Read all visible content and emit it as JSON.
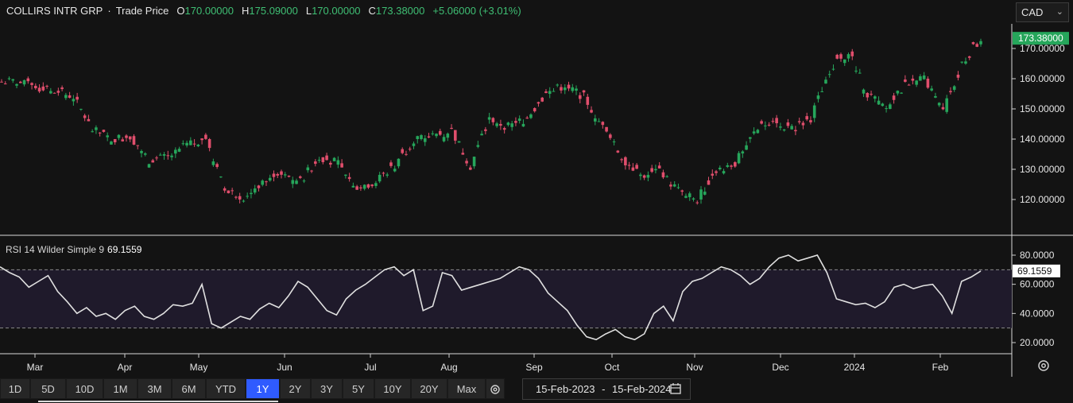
{
  "header": {
    "symbol": "COLLIRS INTR GRP",
    "separator": "·",
    "price_type": "Trade Price",
    "open_label": "O",
    "open": "170.00000",
    "high_label": "H",
    "high": "175.09000",
    "low_label": "L",
    "low": "170.00000",
    "close_label": "C",
    "close": "173.38000",
    "change": "+5.06000 (+3.01%)"
  },
  "currency_select": {
    "value": "CAD",
    "icon": "chevron-down-icon"
  },
  "colors": {
    "background": "#131313",
    "up": "#26a65b",
    "down": "#e04e6c",
    "rsi_line": "#e0e0e0",
    "rsi_band": "#1f1a2b",
    "active": "#2f5bff"
  },
  "rsi": {
    "label": "RSI 14 Wilder Simple 9",
    "value": "69.1559"
  },
  "range_buttons": [
    "1D",
    "5D",
    "10D",
    "1M",
    "3M",
    "6M",
    "YTD",
    "1Y",
    "2Y",
    "3Y",
    "5Y",
    "10Y",
    "20Y",
    "Max"
  ],
  "active_range": "1Y",
  "date_range": {
    "from": "15-Feb-2023",
    "separator": "-",
    "to": "15-Feb-2024",
    "icon": "calendar-icon"
  },
  "chart_data": [
    {
      "type": "candlestick",
      "title": "COLLIRS INTR GRP · Trade Price",
      "x_labels": [
        "Mar",
        "Apr",
        "May",
        "Jun",
        "Jul",
        "Aug",
        "Sep",
        "Oct",
        "Nov",
        "Dec",
        "2024",
        "Feb"
      ],
      "y_ticks": [
        "120.00000",
        "130.00000",
        "140.00000",
        "150.00000",
        "160.00000",
        "170.00000"
      ],
      "ylim": [
        110,
        180
      ],
      "last_price_label": "173.38000",
      "weekly_close_approx": [
        {
          "week": "2023-02-17",
          "close": 159
        },
        {
          "week": "2023-02-24",
          "close": 157
        },
        {
          "week": "2023-03-03",
          "close": 156
        },
        {
          "week": "2023-03-10",
          "close": 154
        },
        {
          "week": "2023-03-17",
          "close": 143
        },
        {
          "week": "2023-03-24",
          "close": 140
        },
        {
          "week": "2023-03-31",
          "close": 141
        },
        {
          "week": "2023-04-07",
          "close": 133
        },
        {
          "week": "2023-04-14",
          "close": 134
        },
        {
          "week": "2023-04-21",
          "close": 138
        },
        {
          "week": "2023-04-28",
          "close": 140
        },
        {
          "week": "2023-05-05",
          "close": 123
        },
        {
          "week": "2023-05-12",
          "close": 121
        },
        {
          "week": "2023-05-19",
          "close": 126
        },
        {
          "week": "2023-05-26",
          "close": 128
        },
        {
          "week": "2023-06-02",
          "close": 126
        },
        {
          "week": "2023-06-09",
          "close": 134
        },
        {
          "week": "2023-06-16",
          "close": 132
        },
        {
          "week": "2023-06-23",
          "close": 124
        },
        {
          "week": "2023-06-30",
          "close": 126
        },
        {
          "week": "2023-07-07",
          "close": 131
        },
        {
          "week": "2023-07-14",
          "close": 140
        },
        {
          "week": "2023-07-21",
          "close": 141
        },
        {
          "week": "2023-07-28",
          "close": 143
        },
        {
          "week": "2023-08-04",
          "close": 131
        },
        {
          "week": "2023-08-11",
          "close": 147
        },
        {
          "week": "2023-08-18",
          "close": 144
        },
        {
          "week": "2023-08-25",
          "close": 147
        },
        {
          "week": "2023-09-01",
          "close": 155
        },
        {
          "week": "2023-09-08",
          "close": 158
        },
        {
          "week": "2023-09-15",
          "close": 154
        },
        {
          "week": "2023-09-22",
          "close": 144
        },
        {
          "week": "2023-09-29",
          "close": 134
        },
        {
          "week": "2023-10-06",
          "close": 128
        },
        {
          "week": "2023-10-13",
          "close": 129
        },
        {
          "week": "2023-10-20",
          "close": 123
        },
        {
          "week": "2023-10-27",
          "close": 120
        },
        {
          "week": "2023-11-03",
          "close": 130
        },
        {
          "week": "2023-11-10",
          "close": 132
        },
        {
          "week": "2023-11-17",
          "close": 142
        },
        {
          "week": "2023-11-24",
          "close": 147
        },
        {
          "week": "2023-12-01",
          "close": 143
        },
        {
          "week": "2023-12-08",
          "close": 147
        },
        {
          "week": "2023-12-15",
          "close": 163
        },
        {
          "week": "2023-12-22",
          "close": 169
        },
        {
          "week": "2024-01-05",
          "close": 155
        },
        {
          "week": "2024-01-12",
          "close": 150
        },
        {
          "week": "2024-01-19",
          "close": 158
        },
        {
          "week": "2024-01-26",
          "close": 160
        },
        {
          "week": "2024-02-02",
          "close": 149
        },
        {
          "week": "2024-02-09",
          "close": 165
        },
        {
          "week": "2024-02-15",
          "close": 173.38
        }
      ]
    },
    {
      "type": "line",
      "title": "RSI 14 Wilder Simple 9",
      "y_ticks": [
        "20.0000",
        "40.0000",
        "60.0000",
        "80.0000"
      ],
      "ylim": [
        15,
        88
      ],
      "reference_lines": [
        30,
        70
      ],
      "last_value_label": "69.1559",
      "values_approx": [
        72,
        68,
        65,
        58,
        62,
        66,
        55,
        48,
        40,
        44,
        38,
        40,
        36,
        42,
        45,
        38,
        36,
        40,
        46,
        45,
        47,
        60,
        33,
        30,
        34,
        38,
        36,
        43,
        47,
        44,
        52,
        62,
        58,
        50,
        42,
        39,
        50,
        56,
        60,
        65,
        70,
        72,
        66,
        70,
        42,
        45,
        68,
        66,
        56,
        58,
        60,
        62,
        64,
        68,
        72,
        70,
        64,
        54,
        48,
        42,
        32,
        24,
        22,
        26,
        29,
        24,
        22,
        26,
        40,
        45,
        35,
        55,
        62,
        64,
        68,
        72,
        70,
        66,
        60,
        64,
        72,
        78,
        80,
        76,
        78,
        80,
        68,
        50,
        48,
        46,
        47,
        44,
        48,
        58,
        60,
        57,
        59,
        60,
        52,
        40,
        62,
        65,
        69.16
      ]
    }
  ]
}
